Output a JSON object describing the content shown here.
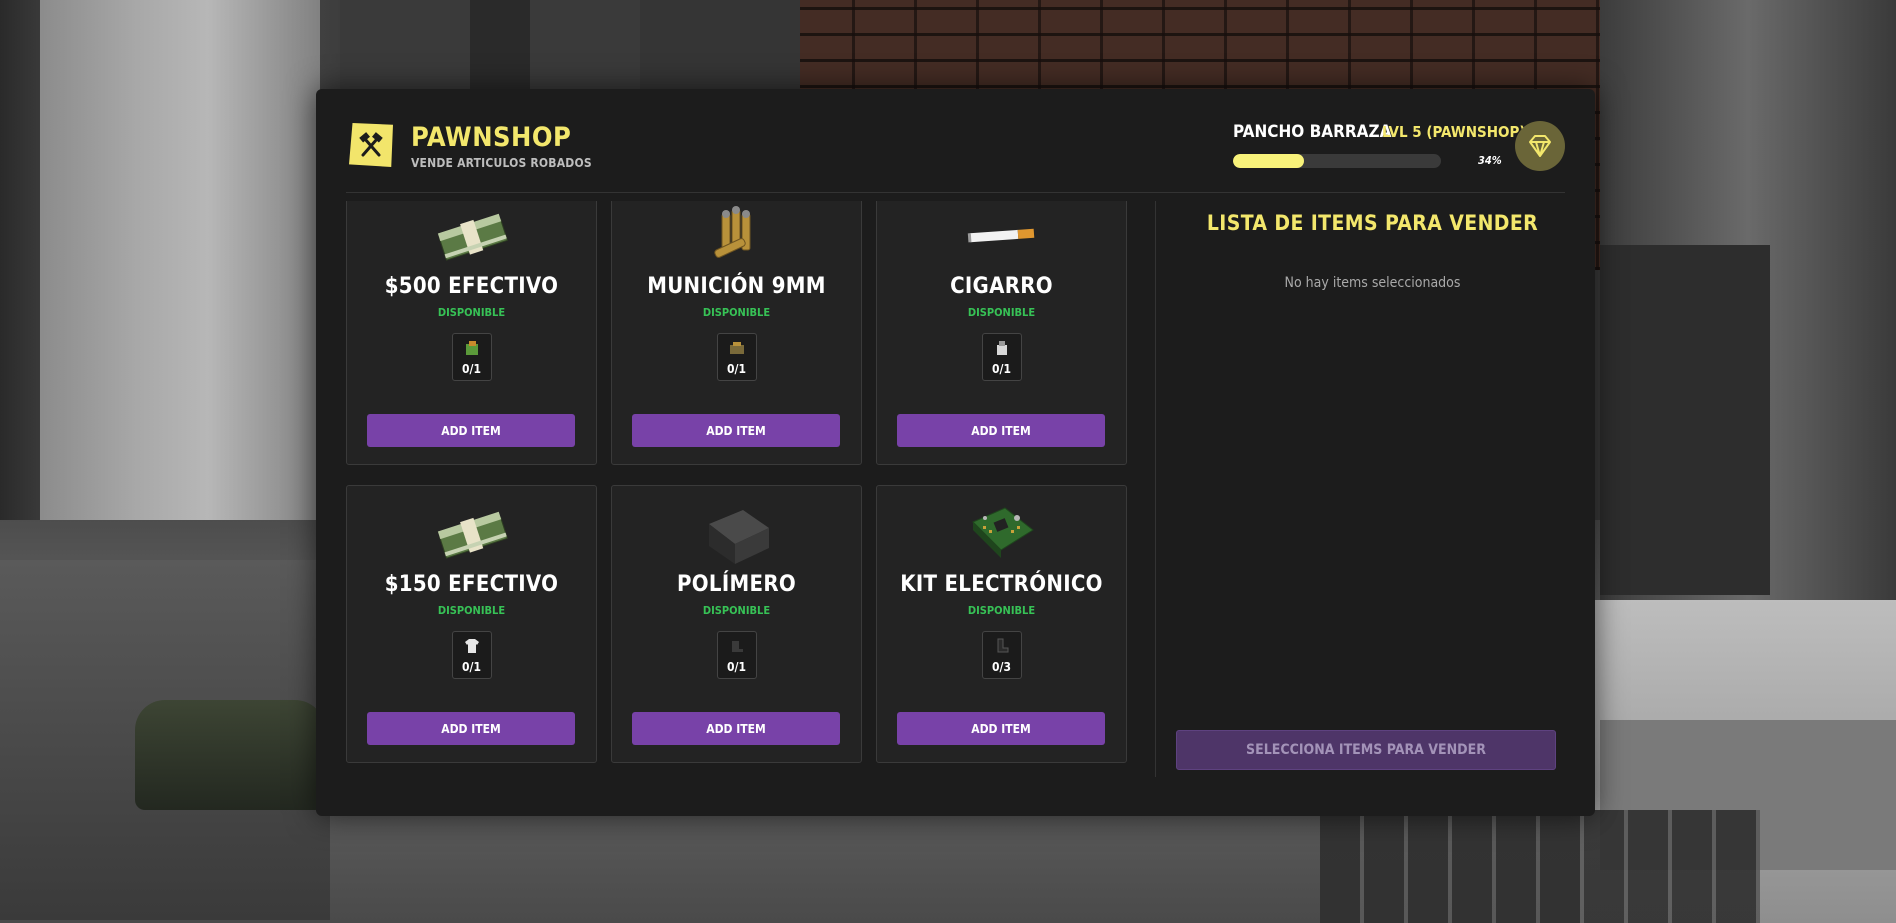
{
  "header": {
    "title": "PAWNSHOP",
    "subtitle": "VENDE ARTICULOS ROBADOS",
    "logo_icon": "crossed-hammers-icon"
  },
  "player": {
    "name": "PANCHO BARRAZA",
    "level": "LVL 5 (PAWNSHOP)",
    "progress_percent": 34,
    "progress_text": "34%",
    "badge_icon": "diamond-icon"
  },
  "items": [
    {
      "name": "$500 EFECTIVO",
      "status": "DISPONIBLE",
      "quantity": "0/1",
      "button": "ADD ITEM",
      "icon": "cash-stack-icon",
      "mini_icon": "money-bag-icon"
    },
    {
      "name": "MUNICIÓN 9MM",
      "status": "DISPONIBLE",
      "quantity": "0/1",
      "button": "ADD ITEM",
      "icon": "bullets-icon",
      "mini_icon": "ammo-box-icon"
    },
    {
      "name": "CIGARRO",
      "status": "DISPONIBLE",
      "quantity": "0/1",
      "button": "ADD ITEM",
      "icon": "cigarette-icon",
      "mini_icon": "lighter-icon"
    },
    {
      "name": "$150 EFECTIVO",
      "status": "DISPONIBLE",
      "quantity": "0/1",
      "button": "ADD ITEM",
      "icon": "cash-stack-icon",
      "mini_icon": "shirt-icon"
    },
    {
      "name": "POLÍMERO",
      "status": "DISPONIBLE",
      "quantity": "0/1",
      "button": "ADD ITEM",
      "icon": "polymer-block-icon",
      "mini_icon": "shoe-icon"
    },
    {
      "name": "KIT ELECTRÓNICO",
      "status": "DISPONIBLE",
      "quantity": "0/3",
      "button": "ADD ITEM",
      "icon": "circuit-board-icon",
      "mini_icon": "boot-icon"
    }
  ],
  "sell_list": {
    "title": "LISTA DE ITEMS PARA VENDER",
    "empty_text": "No hay items seleccionados",
    "sell_button": "SELECCIONA ITEMS PARA VENDER"
  },
  "colors": {
    "accent": "#f3e76c",
    "button": "#7842a8",
    "status": "#37c256",
    "panel": "#1c1c1c"
  }
}
